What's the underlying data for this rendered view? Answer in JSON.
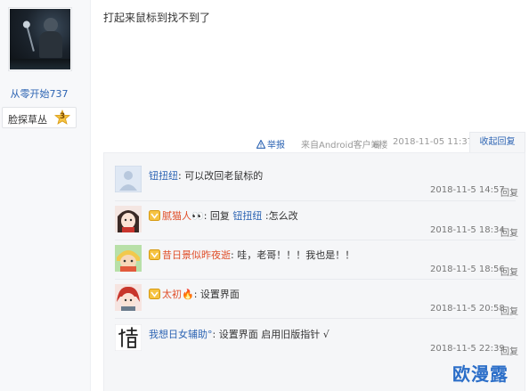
{
  "author": {
    "username": "从零开始737",
    "badge_name": "脸探草丛",
    "badge_level": "3"
  },
  "post": {
    "content": "打起来鼠标到找不到了",
    "report_label": "举报",
    "from_label": "来自Android客户端",
    "floor": "6楼",
    "time": "2018-11-05 11:37",
    "collapse_label": "收起回复"
  },
  "replies": [
    {
      "name": "钮扭纽",
      "name_color": "blue",
      "vip": false,
      "separator": ": ",
      "prefix": "",
      "mention": "",
      "text": "可以改回老鼠标的",
      "time": "2018-11-5 14:57",
      "reply_label": "回复",
      "avatar": "default-avatar-icon"
    },
    {
      "name": "腻猫人👀",
      "name_color": "red",
      "vip": true,
      "separator": ": ",
      "prefix": "回复 ",
      "mention": "钮扭纽",
      "text": " :怎么改",
      "time": "2018-11-5 18:34",
      "reply_label": "回复",
      "avatar": "anime-girl-avatar"
    },
    {
      "name": "昔日景似昨夜逝",
      "name_color": "red",
      "vip": true,
      "separator": ": ",
      "prefix": "",
      "mention": "",
      "text": "哇，老哥！！！我也是！！",
      "time": "2018-11-5 18:56",
      "reply_label": "回复",
      "avatar": "cartoon-avatar"
    },
    {
      "name": "太初🔥",
      "name_color": "red",
      "vip": true,
      "separator": ": ",
      "prefix": "",
      "mention": "",
      "text": "设置界面",
      "time": "2018-11-5 20:58",
      "reply_label": "回复",
      "avatar": "red-hair-avatar"
    },
    {
      "name": "我想日女辅助°",
      "name_color": "blue",
      "vip": false,
      "separator": ": ",
      "prefix": "",
      "mention": "",
      "text": "设置界面 启用旧版指针 √",
      "time": "2018-11-5 22:39",
      "reply_label": "回复",
      "avatar": "calligraphy-avatar"
    }
  ],
  "watermark": "欧漫露",
  "colors": {
    "link_blue": "#2d64b3",
    "name_red": "#e0502b",
    "reply_bg": "#f5f6f8"
  }
}
